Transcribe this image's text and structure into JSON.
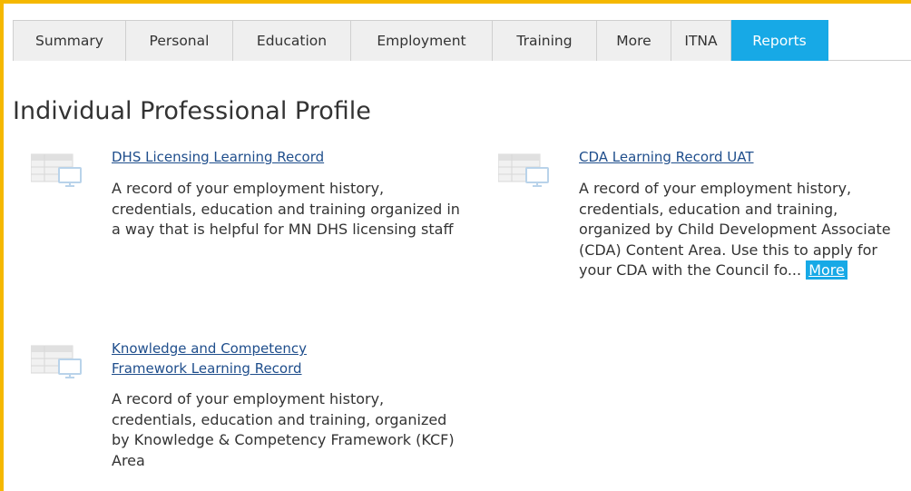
{
  "tabs": [
    {
      "label": "Summary",
      "active": false
    },
    {
      "label": "Personal",
      "active": false
    },
    {
      "label": "Education",
      "active": false
    },
    {
      "label": "Employment",
      "active": false
    },
    {
      "label": "Training",
      "active": false
    },
    {
      "label": "More",
      "active": false
    },
    {
      "label": "ITNA",
      "active": false
    },
    {
      "label": "Reports",
      "active": true
    }
  ],
  "page": {
    "title": "Individual Professional Profile"
  },
  "reports": [
    {
      "icon": "report-table-icon",
      "link": "DHS Licensing Learning Record",
      "description": "A record of your employment history, credentials, education and training organized in a way that is helpful for MN DHS licensing staff"
    },
    {
      "icon": "report-table-icon",
      "link": "CDA Learning Record UAT",
      "description": "A record of your employment history, credentials, education and training, organized by Child Development Associate (CDA) Content Area. Use this to apply for your CDA with the Council fo...",
      "more_label": "More"
    },
    {
      "icon": "report-table-icon",
      "link": "Knowledge and Competency Framework Learning Record",
      "description": "A record of your employment history, credentials, education and training, organized by Knowledge & Competency Framework (KCF) Area"
    }
  ],
  "colors": {
    "frame": "#f5b800",
    "active_tab": "#17a9e6",
    "link": "#1f4e8c",
    "tab_bg": "#efefef"
  }
}
